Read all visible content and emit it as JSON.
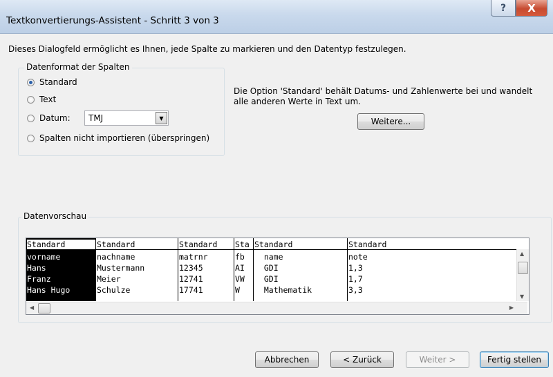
{
  "window": {
    "title": "Textkonvertierungs-Assistent - Schritt 3 von 3",
    "help_label": "?",
    "close_label": "X"
  },
  "intro": "Dieses Dialogfeld ermöglicht es Ihnen, jede Spalte zu markieren und den Datentyp festzulegen.",
  "column_format": {
    "legend": "Datenformat der Spalten",
    "options": [
      {
        "label": "Standard",
        "checked": true
      },
      {
        "label": "Text",
        "checked": false
      },
      {
        "label": "Datum:",
        "checked": false
      },
      {
        "label": "Spalten nicht importieren (überspringen)",
        "checked": false
      }
    ],
    "date_format": "TMJ"
  },
  "info_text": "Die Option 'Standard' behält Datums- und Zahlenwerte bei und wandelt alle anderen Werte in Text um.",
  "more_button": "Weitere...",
  "preview": {
    "legend": "Datenvorschau",
    "columns": [
      {
        "header": "Standard",
        "cells": [
          "vorname",
          "Hans",
          "Franz",
          "Hans Hugo"
        ]
      },
      {
        "header": "Standard",
        "cells": [
          "nachname",
          "Mustermann",
          "Meier",
          "Schulze"
        ]
      },
      {
        "header": "Standard",
        "cells": [
          "matrnr",
          "12345",
          "12741",
          "17741"
        ]
      },
      {
        "header": "Sta",
        "cells": [
          "fb",
          "AI",
          "VW",
          "W"
        ]
      },
      {
        "header": "Standard",
        "cells": [
          "  name",
          "  GDI",
          "  GDI",
          "  Mathematik"
        ]
      },
      {
        "header": "Standard",
        "cells": [
          "note",
          "1,3",
          "1,7",
          "3,3"
        ]
      }
    ]
  },
  "buttons": {
    "cancel": "Abbrechen",
    "back": "< Zurück",
    "next": "Weiter >",
    "finish": "Fertig stellen"
  }
}
